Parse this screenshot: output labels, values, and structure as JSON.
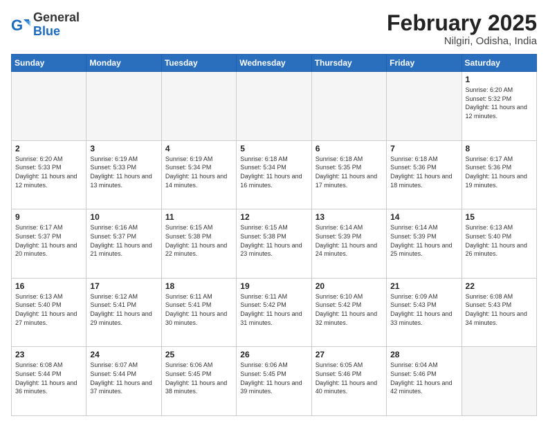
{
  "logo": {
    "general": "General",
    "blue": "Blue"
  },
  "title": "February 2025",
  "location": "Nilgiri, Odisha, India",
  "weekdays": [
    "Sunday",
    "Monday",
    "Tuesday",
    "Wednesday",
    "Thursday",
    "Friday",
    "Saturday"
  ],
  "weeks": [
    [
      {
        "day": "",
        "info": ""
      },
      {
        "day": "",
        "info": ""
      },
      {
        "day": "",
        "info": ""
      },
      {
        "day": "",
        "info": ""
      },
      {
        "day": "",
        "info": ""
      },
      {
        "day": "",
        "info": ""
      },
      {
        "day": "1",
        "info": "Sunrise: 6:20 AM\nSunset: 5:32 PM\nDaylight: 11 hours and 12 minutes."
      }
    ],
    [
      {
        "day": "2",
        "info": "Sunrise: 6:20 AM\nSunset: 5:33 PM\nDaylight: 11 hours and 12 minutes."
      },
      {
        "day": "3",
        "info": "Sunrise: 6:19 AM\nSunset: 5:33 PM\nDaylight: 11 hours and 13 minutes."
      },
      {
        "day": "4",
        "info": "Sunrise: 6:19 AM\nSunset: 5:34 PM\nDaylight: 11 hours and 14 minutes."
      },
      {
        "day": "5",
        "info": "Sunrise: 6:18 AM\nSunset: 5:34 PM\nDaylight: 11 hours and 16 minutes."
      },
      {
        "day": "6",
        "info": "Sunrise: 6:18 AM\nSunset: 5:35 PM\nDaylight: 11 hours and 17 minutes."
      },
      {
        "day": "7",
        "info": "Sunrise: 6:18 AM\nSunset: 5:36 PM\nDaylight: 11 hours and 18 minutes."
      },
      {
        "day": "8",
        "info": "Sunrise: 6:17 AM\nSunset: 5:36 PM\nDaylight: 11 hours and 19 minutes."
      }
    ],
    [
      {
        "day": "9",
        "info": "Sunrise: 6:17 AM\nSunset: 5:37 PM\nDaylight: 11 hours and 20 minutes."
      },
      {
        "day": "10",
        "info": "Sunrise: 6:16 AM\nSunset: 5:37 PM\nDaylight: 11 hours and 21 minutes."
      },
      {
        "day": "11",
        "info": "Sunrise: 6:15 AM\nSunset: 5:38 PM\nDaylight: 11 hours and 22 minutes."
      },
      {
        "day": "12",
        "info": "Sunrise: 6:15 AM\nSunset: 5:38 PM\nDaylight: 11 hours and 23 minutes."
      },
      {
        "day": "13",
        "info": "Sunrise: 6:14 AM\nSunset: 5:39 PM\nDaylight: 11 hours and 24 minutes."
      },
      {
        "day": "14",
        "info": "Sunrise: 6:14 AM\nSunset: 5:39 PM\nDaylight: 11 hours and 25 minutes."
      },
      {
        "day": "15",
        "info": "Sunrise: 6:13 AM\nSunset: 5:40 PM\nDaylight: 11 hours and 26 minutes."
      }
    ],
    [
      {
        "day": "16",
        "info": "Sunrise: 6:13 AM\nSunset: 5:40 PM\nDaylight: 11 hours and 27 minutes."
      },
      {
        "day": "17",
        "info": "Sunrise: 6:12 AM\nSunset: 5:41 PM\nDaylight: 11 hours and 29 minutes."
      },
      {
        "day": "18",
        "info": "Sunrise: 6:11 AM\nSunset: 5:41 PM\nDaylight: 11 hours and 30 minutes."
      },
      {
        "day": "19",
        "info": "Sunrise: 6:11 AM\nSunset: 5:42 PM\nDaylight: 11 hours and 31 minutes."
      },
      {
        "day": "20",
        "info": "Sunrise: 6:10 AM\nSunset: 5:42 PM\nDaylight: 11 hours and 32 minutes."
      },
      {
        "day": "21",
        "info": "Sunrise: 6:09 AM\nSunset: 5:43 PM\nDaylight: 11 hours and 33 minutes."
      },
      {
        "day": "22",
        "info": "Sunrise: 6:08 AM\nSunset: 5:43 PM\nDaylight: 11 hours and 34 minutes."
      }
    ],
    [
      {
        "day": "23",
        "info": "Sunrise: 6:08 AM\nSunset: 5:44 PM\nDaylight: 11 hours and 36 minutes."
      },
      {
        "day": "24",
        "info": "Sunrise: 6:07 AM\nSunset: 5:44 PM\nDaylight: 11 hours and 37 minutes."
      },
      {
        "day": "25",
        "info": "Sunrise: 6:06 AM\nSunset: 5:45 PM\nDaylight: 11 hours and 38 minutes."
      },
      {
        "day": "26",
        "info": "Sunrise: 6:06 AM\nSunset: 5:45 PM\nDaylight: 11 hours and 39 minutes."
      },
      {
        "day": "27",
        "info": "Sunrise: 6:05 AM\nSunset: 5:46 PM\nDaylight: 11 hours and 40 minutes."
      },
      {
        "day": "28",
        "info": "Sunrise: 6:04 AM\nSunset: 5:46 PM\nDaylight: 11 hours and 42 minutes."
      },
      {
        "day": "",
        "info": ""
      }
    ]
  ]
}
